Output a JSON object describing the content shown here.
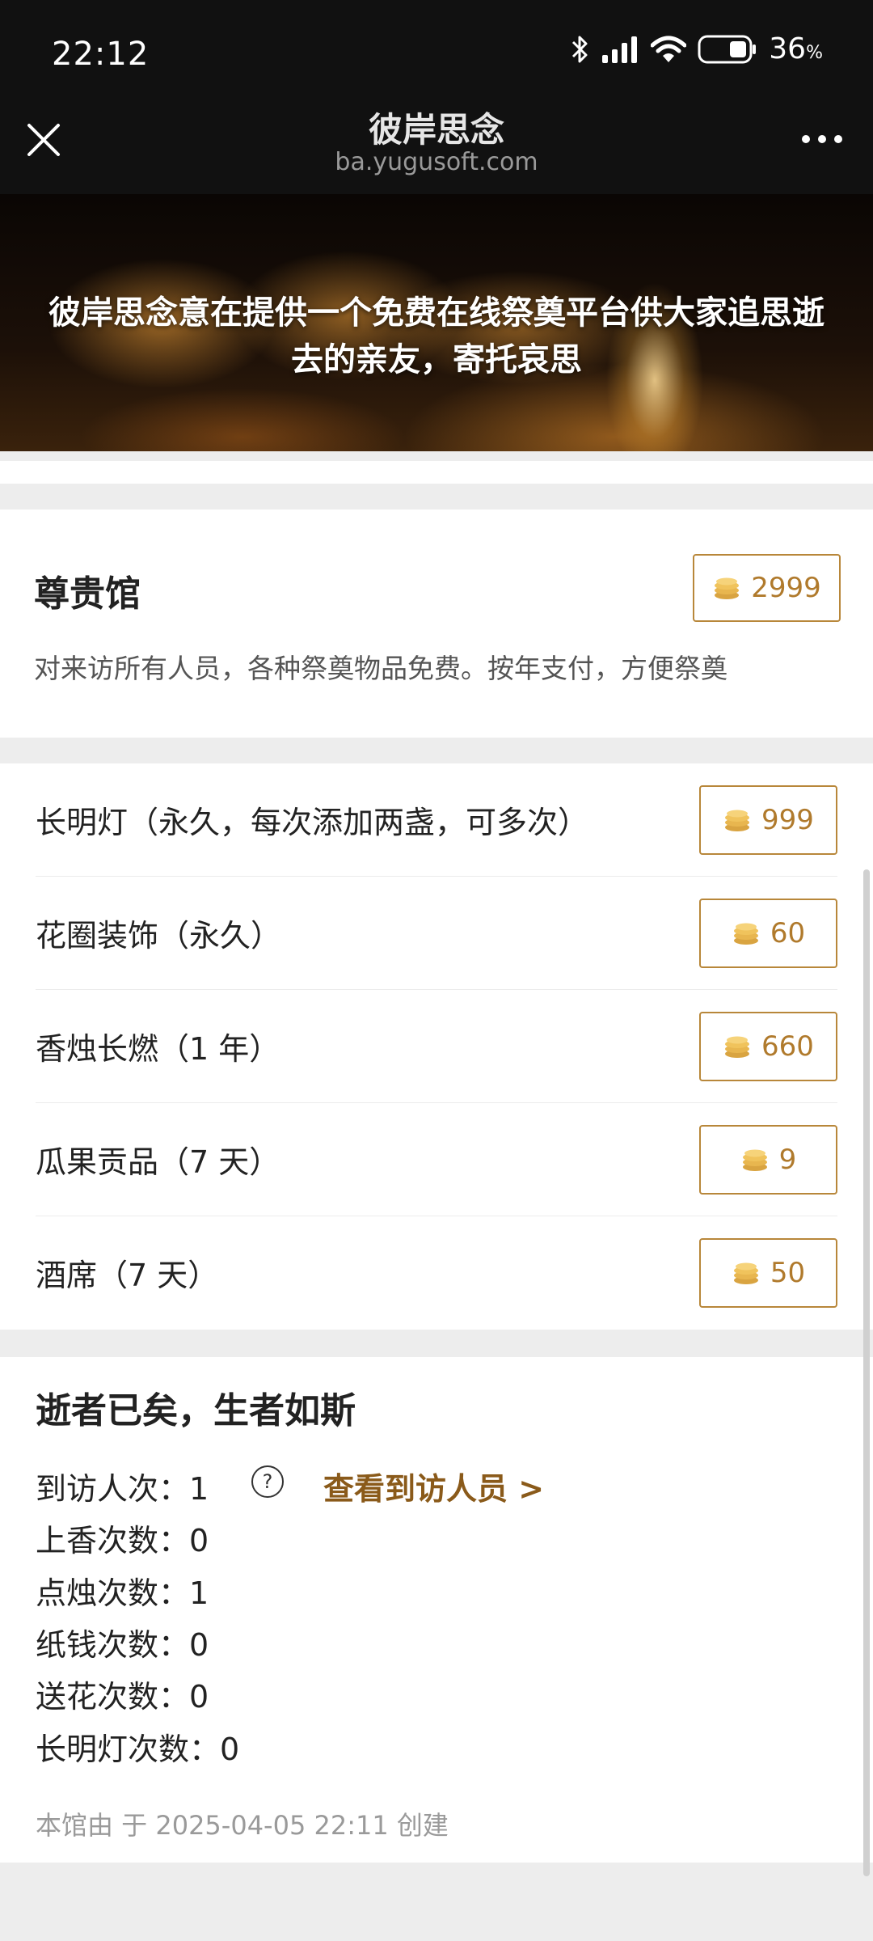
{
  "status_bar": {
    "time": "22:12",
    "battery_value": "36",
    "battery_unit": "%",
    "icons": [
      "bluetooth-icon",
      "signal-icon",
      "wifi-icon",
      "battery-icon"
    ]
  },
  "title_bar": {
    "title": "彼岸思念",
    "url": "ba.yugusoft.com"
  },
  "banner": {
    "text": "彼岸思念意在提供一个免费在线祭奠平台供大家追思逝去的亲友，寄托哀思"
  },
  "vip": {
    "title": "尊贵馆",
    "price": "2999",
    "description": "对来访所有人员，各种祭奠物品免费。按年支付，方便祭奠"
  },
  "items": [
    {
      "label": "长明灯（永久，每次添加两盏，可多次）",
      "price": "999"
    },
    {
      "label": "花圈装饰（永久）",
      "price": "60"
    },
    {
      "label": "香烛长燃（1 年）",
      "price": "660"
    },
    {
      "label": "瓜果贡品（7 天）",
      "price": "9"
    },
    {
      "label": "酒席（7 天）",
      "price": "50"
    }
  ],
  "stats": {
    "title": "逝者已矣，生者如斯",
    "visits": "到访人次：1",
    "view_visitors": "查看到访人员 >",
    "incense": "上香次数：0",
    "candles": "点烛次数：1",
    "paper_money": "纸钱次数：0",
    "flowers": "送花次数：0",
    "lamps": "长明灯次数：0",
    "created": "本馆由 于 2025-04-05 22:11 创建"
  },
  "colors": {
    "accent_gold": "#b8873a",
    "link_brown": "#8a5a1a",
    "header_bg": "#111111"
  }
}
